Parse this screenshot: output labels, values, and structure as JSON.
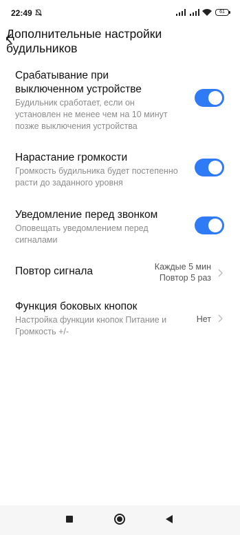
{
  "status_bar": {
    "time": "22:49",
    "battery": "61",
    "icons": [
      "bell-off-icon",
      "signal-icon",
      "signal-icon",
      "wifi-icon",
      "battery-icon"
    ]
  },
  "header": {
    "back_icon": "chevron-left-icon",
    "title": "Дополнительные настройки будильников"
  },
  "settings": [
    {
      "title": "Срабатывание при выключенном устройстве",
      "subtitle": "Будильник сработает, если он установлен не менее чем на 10 минут позже выключения устройства",
      "toggle": true
    },
    {
      "title": "Нарастание громкости",
      "subtitle": "Громкость будильника будет постепенно расти до заданного уровня",
      "toggle": true
    },
    {
      "title": "Уведомление перед звонком",
      "subtitle": "Оповещать уведомлением перед сигналами",
      "toggle": true
    },
    {
      "title": "Повтор сигнала",
      "value_line1": "Каждые 5 мин",
      "value_line2": "Повтор 5 раз"
    },
    {
      "title": "Функция боковых кнопок",
      "subtitle": "Настройка функции кнопок Питание и Громкость +/-",
      "value": "Нет"
    }
  ],
  "colors": {
    "accent": "#2f7bf5",
    "subtitle": "#8c8c8c",
    "background": "#ffffff"
  },
  "nav_bar": {
    "icons": [
      "recents-square-icon",
      "home-circle-icon",
      "back-triangle-icon"
    ]
  }
}
